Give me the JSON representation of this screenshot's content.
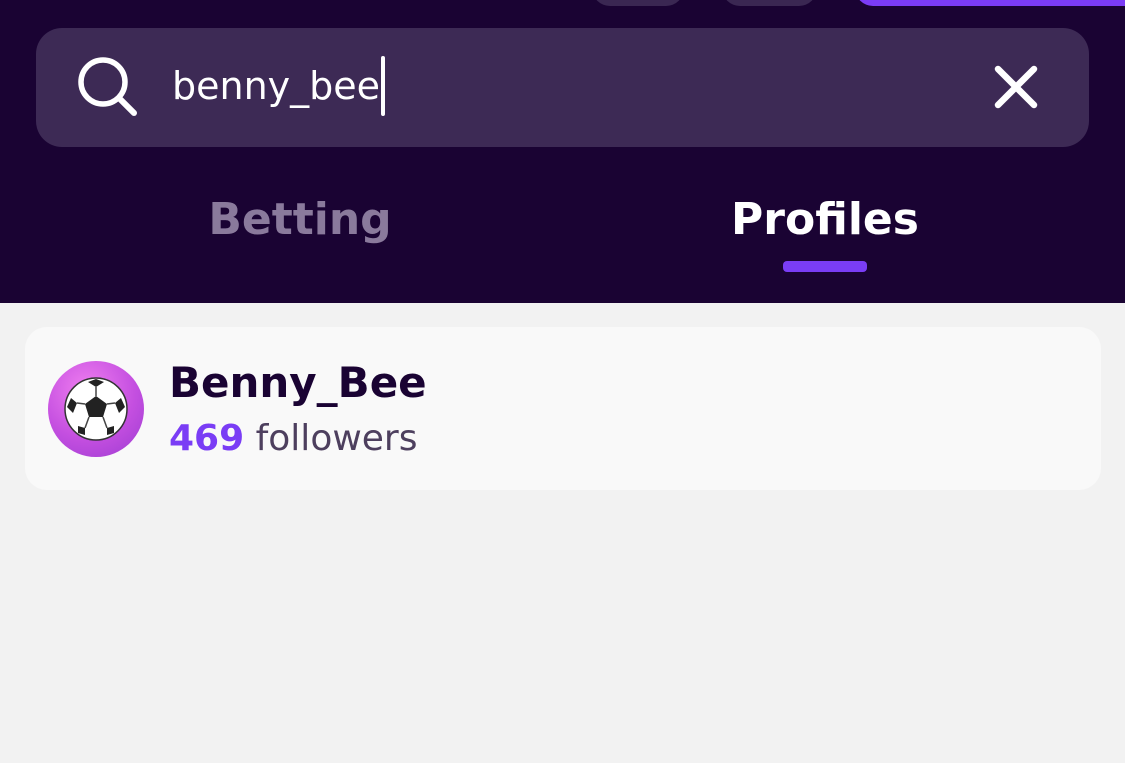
{
  "search": {
    "value": "benny_bee"
  },
  "tabs": {
    "betting_label": "Betting",
    "profiles_label": "Profiles",
    "active": "Profiles"
  },
  "results": [
    {
      "name": "Benny_Bee",
      "followers_count": "469",
      "followers_label": "followers",
      "avatar_icon": "soccer-ball-icon"
    }
  ],
  "colors": {
    "header_bg": "#1a0333",
    "search_bg": "#3d2a55",
    "accent": "#7a3df5",
    "page_bg": "#f2f2f2",
    "card_bg": "#f9f9f9"
  }
}
